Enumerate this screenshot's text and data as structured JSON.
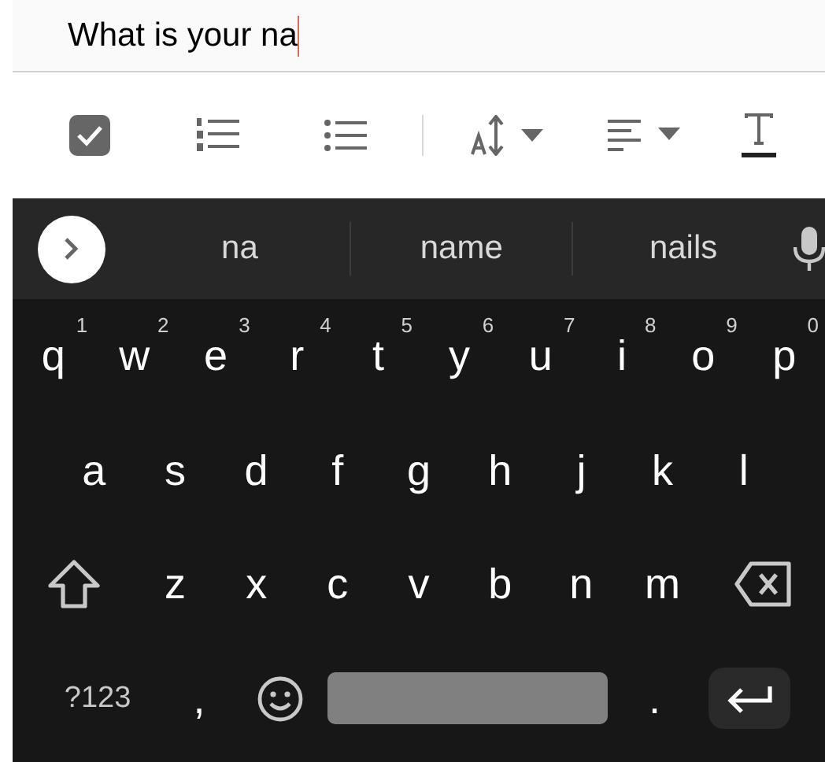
{
  "input": {
    "value": "What is your na"
  },
  "suggestions": [
    "na",
    "name",
    "nails"
  ],
  "rows": [
    [
      {
        "kind": "letter",
        "label": "q",
        "hint": "1"
      },
      {
        "kind": "letter",
        "label": "w",
        "hint": "2"
      },
      {
        "kind": "letter",
        "label": "e",
        "hint": "3"
      },
      {
        "kind": "letter",
        "label": "r",
        "hint": "4"
      },
      {
        "kind": "letter",
        "label": "t",
        "hint": "5"
      },
      {
        "kind": "letter",
        "label": "y",
        "hint": "6"
      },
      {
        "kind": "letter",
        "label": "u",
        "hint": "7"
      },
      {
        "kind": "letter",
        "label": "i",
        "hint": "8"
      },
      {
        "kind": "letter",
        "label": "o",
        "hint": "9"
      },
      {
        "kind": "letter",
        "label": "p",
        "hint": "0"
      }
    ],
    [
      {
        "kind": "letter",
        "label": "a"
      },
      {
        "kind": "letter",
        "label": "s"
      },
      {
        "kind": "letter",
        "label": "d"
      },
      {
        "kind": "letter",
        "label": "f"
      },
      {
        "kind": "letter",
        "label": "g"
      },
      {
        "kind": "letter",
        "label": "h"
      },
      {
        "kind": "letter",
        "label": "j"
      },
      {
        "kind": "letter",
        "label": "k"
      },
      {
        "kind": "letter",
        "label": "l"
      }
    ],
    [
      {
        "kind": "shift"
      },
      {
        "kind": "letter",
        "label": "z"
      },
      {
        "kind": "letter",
        "label": "x"
      },
      {
        "kind": "letter",
        "label": "c"
      },
      {
        "kind": "letter",
        "label": "v"
      },
      {
        "kind": "letter",
        "label": "b"
      },
      {
        "kind": "letter",
        "label": "n"
      },
      {
        "kind": "letter",
        "label": "m"
      },
      {
        "kind": "backspace"
      }
    ],
    [
      {
        "kind": "symbols",
        "label": "?123"
      },
      {
        "kind": "letter",
        "label": ","
      },
      {
        "kind": "emoji"
      },
      {
        "kind": "space"
      },
      {
        "kind": "letter",
        "label": "."
      },
      {
        "kind": "enter"
      }
    ]
  ]
}
